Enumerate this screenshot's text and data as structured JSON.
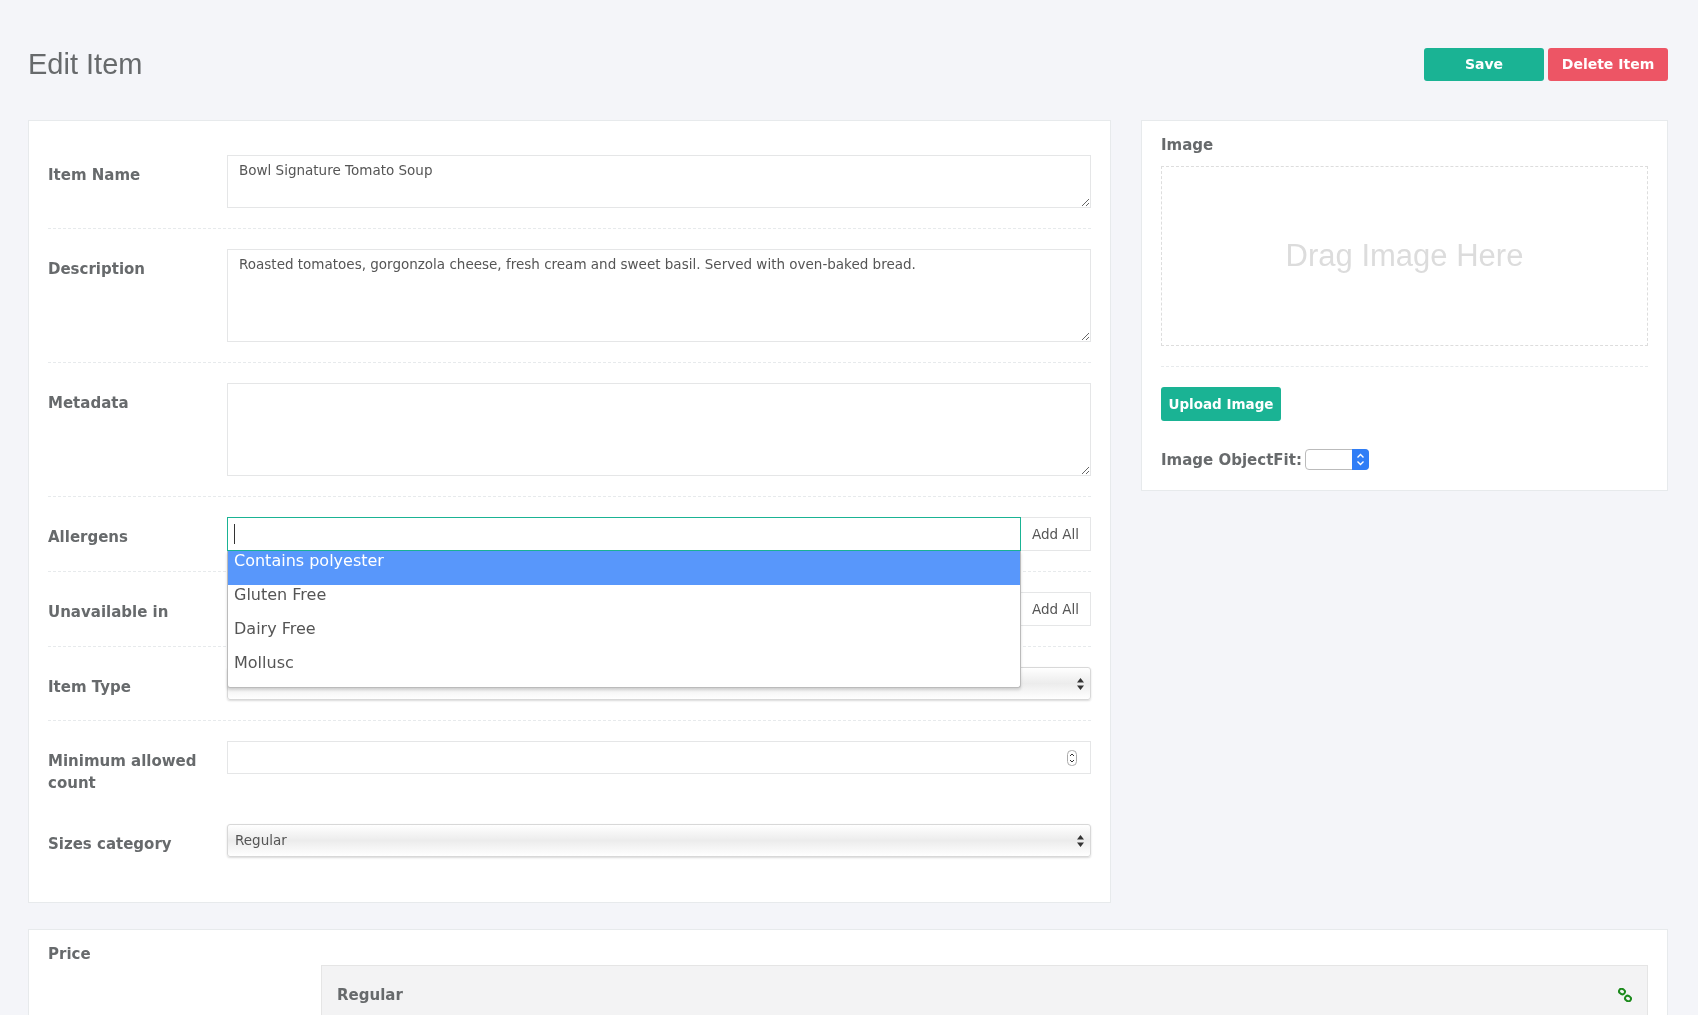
{
  "page": {
    "title": "Edit Item"
  },
  "actions": [
    {
      "label": "Save",
      "kind": "primary"
    },
    {
      "label": "Delete Item",
      "kind": "danger"
    }
  ],
  "form": {
    "fields": [
      {
        "label": "Item Name",
        "kind": "line",
        "value": "Bowl Signature Tomato Soup"
      },
      {
        "label": "Description",
        "kind": "textarea",
        "value": "Roasted tomatoes, gorgonzola cheese, fresh cream and sweet basil. Served with oven-baked bread."
      },
      {
        "label": "Metadata",
        "kind": "textarea"
      },
      {
        "label": "Allergens",
        "kind": "tags",
        "button": "Add All",
        "focused": true
      },
      {
        "label": "Unavailable in",
        "kind": "tags",
        "button": "Add All"
      },
      {
        "label": "Item Type",
        "kind": "select"
      },
      {
        "label": "Minimum allowed count",
        "kind": "number"
      },
      {
        "label": "Sizes category",
        "kind": "select",
        "value": "Regular"
      }
    ],
    "dropdown": {
      "options": [
        {
          "label": "Contains polyester",
          "selected": true
        },
        {
          "label": "Gluten Free",
          "selected": false
        },
        {
          "label": "Dairy Free",
          "selected": false
        },
        {
          "label": "Mollusc",
          "selected": false
        }
      ]
    }
  },
  "image": {
    "title": "Image",
    "dropzone": "Drag Image Here",
    "upload": "Upload Image",
    "objectfit_label": "Image ObjectFit:"
  },
  "price": {
    "title": "Price",
    "sizes": [
      {
        "name": "Regular"
      }
    ]
  }
}
